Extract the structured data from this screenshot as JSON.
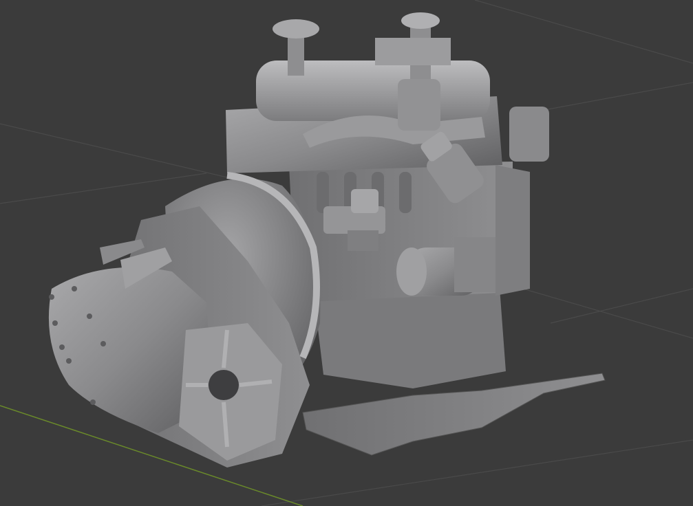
{
  "viewport": {
    "background_color": "#3b3b3b",
    "grid_color": "#4a4a4a",
    "x_axis_color": "#6a8a2a",
    "model_color": "#8c8c8e",
    "model_shadow_color": "#5a5a5c",
    "model_highlight_color": "#b8b8ba"
  }
}
